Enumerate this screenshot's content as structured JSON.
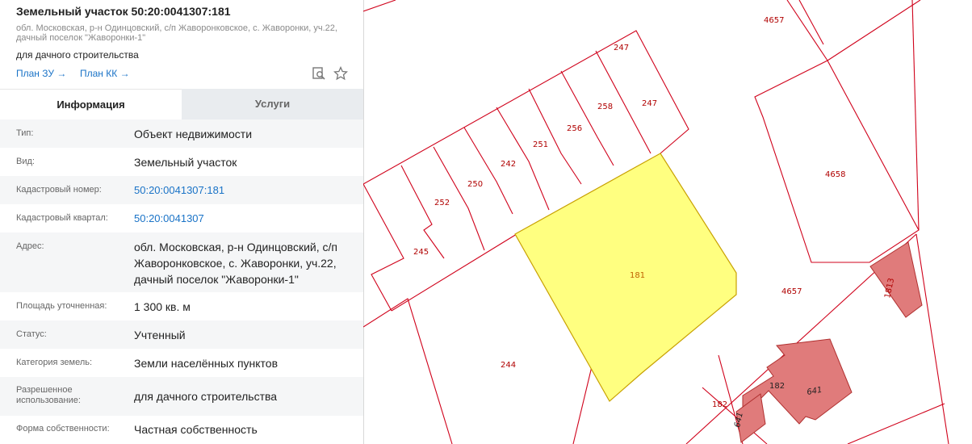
{
  "header": {
    "title": "Земельный участок 50:20:0041307:181",
    "address_line1": "обл. Московская, р-н Одинцовский, с/п Жаворонковское, с. Жаворонки, уч.22,",
    "address_line2": "дачный поселок \"Жаворонки-1\"",
    "purpose": "для дачного строительства",
    "link_zu": "План ЗУ →",
    "link_kk": "План КК →",
    "icons": [
      "search-doc-icon",
      "star-icon"
    ]
  },
  "tabs": {
    "info": "Информация",
    "services": "Услуги"
  },
  "fields": [
    {
      "label": "Тип:",
      "value": "Объект недвижимости"
    },
    {
      "label": "Вид:",
      "value": "Земельный участок"
    },
    {
      "label": "Кадастровый номер:",
      "value": "50:20:0041307:181"
    },
    {
      "label": "Кадастровый квартал:",
      "value": "50:20:0041307"
    },
    {
      "label": "Адрес:",
      "value_lines": [
        "обл. Московская, р-н Одинцовский, с/п",
        "Жаворонковское, с. Жаворонки, уч.22,",
        "дачный поселок \"Жаворонки-1\""
      ]
    },
    {
      "label": "Площадь уточненная:",
      "value": "1 300 кв. м"
    },
    {
      "label": "Статус:",
      "value": "Учтенный"
    },
    {
      "label": "Категория земель:",
      "value": "Земли населённых пунктов"
    },
    {
      "label_lines": [
        "Разрешенное",
        "использование:"
      ],
      "value": "для дачного строительства"
    },
    {
      "label": "Форма собственности:",
      "value": "Частная собственность"
    }
  ],
  "map": {
    "colors": {
      "boundary": "#d0021b",
      "selected_fill": "#ffff80",
      "building_fill": "#e07b7b",
      "label": "#b00000"
    },
    "labels": {
      "p4657_top": "4657",
      "p247_a": "247",
      "p247_b": "247",
      "p258": "258",
      "p256": "256",
      "p251": "251",
      "p242": "242",
      "p250": "250",
      "p252": "252",
      "p245": "245",
      "p181": "181",
      "p4658": "4658",
      "p4657_mid": "4657",
      "p1813": "1813",
      "p244": "244",
      "p182_a": "182",
      "p182_b": "182",
      "p641_a": "641",
      "p641_b": "641"
    }
  }
}
